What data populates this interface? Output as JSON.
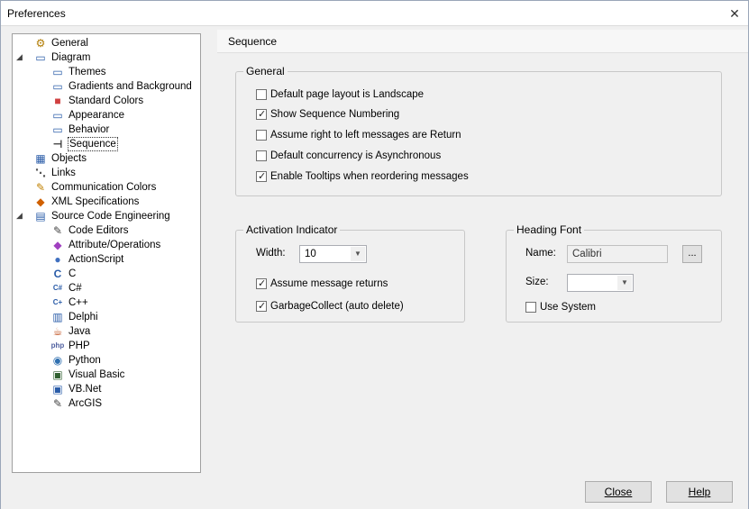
{
  "window": {
    "title": "Preferences",
    "close_glyph": "✕"
  },
  "tree": {
    "items": [
      {
        "label": "General",
        "icon": "general-icon",
        "level": 0
      },
      {
        "label": "Diagram",
        "icon": "diagram-icon",
        "level": 0,
        "expanded": true
      },
      {
        "label": "Themes",
        "icon": "page-icon",
        "level": 1
      },
      {
        "label": "Gradients and Background",
        "icon": "page-icon",
        "level": 1
      },
      {
        "label": "Standard Colors",
        "icon": "colors-icon",
        "level": 1
      },
      {
        "label": "Appearance",
        "icon": "page-icon",
        "level": 1
      },
      {
        "label": "Behavior",
        "icon": "page-icon",
        "level": 1
      },
      {
        "label": "Sequence",
        "icon": "sequence-icon",
        "level": 1,
        "selected": true
      },
      {
        "label": "Objects",
        "icon": "objects-icon",
        "level": 0
      },
      {
        "label": "Links",
        "icon": "links-icon",
        "level": 0
      },
      {
        "label": "Communication Colors",
        "icon": "communication-colors-icon",
        "level": 0
      },
      {
        "label": "XML Specifications",
        "icon": "xml-icon",
        "level": 0
      },
      {
        "label": "Source Code Engineering",
        "icon": "source-code-icon",
        "level": 0,
        "expanded": true
      },
      {
        "label": "Code Editors",
        "icon": "code-editor-icon",
        "level": 1
      },
      {
        "label": "Attribute/Operations",
        "icon": "attribute-icon",
        "level": 1
      },
      {
        "label": "ActionScript",
        "icon": "actionscript-icon",
        "level": 1
      },
      {
        "label": "C",
        "icon": "c-icon",
        "level": 1
      },
      {
        "label": "C#",
        "icon": "csharp-icon",
        "level": 1
      },
      {
        "label": "C++",
        "icon": "cpp-icon",
        "level": 1
      },
      {
        "label": "Delphi",
        "icon": "delphi-icon",
        "level": 1
      },
      {
        "label": "Java",
        "icon": "java-icon",
        "level": 1
      },
      {
        "label": "PHP",
        "icon": "php-icon",
        "level": 1
      },
      {
        "label": "Python",
        "icon": "python-icon",
        "level": 1
      },
      {
        "label": "Visual Basic",
        "icon": "visual-basic-icon",
        "level": 1
      },
      {
        "label": "VB.Net",
        "icon": "vbnet-icon",
        "level": 1
      },
      {
        "label": "ArcGIS",
        "icon": "arcgis-icon",
        "level": 1
      }
    ]
  },
  "panel": {
    "title": "Sequence",
    "general": {
      "title": "General",
      "options": [
        {
          "label": "Default page layout is Landscape",
          "checked": false
        },
        {
          "label": "Show Sequence Numbering",
          "checked": true
        },
        {
          "label": "Assume right to left messages are Return",
          "checked": false
        },
        {
          "label": "Default concurrency is Asynchronous",
          "checked": false
        },
        {
          "label": "Enable Tooltips when reordering messages",
          "checked": true
        }
      ]
    },
    "activation": {
      "title": "Activation Indicator",
      "width_label": "Width:",
      "width_value": "10",
      "options": [
        {
          "label": "Assume message returns",
          "checked": true
        },
        {
          "label": "GarbageCollect (auto delete)",
          "checked": true
        }
      ]
    },
    "heading_font": {
      "title": "Heading Font",
      "name_label": "Name:",
      "name_value": "Calibri",
      "browse_label": "...",
      "size_label": "Size:",
      "size_value": "",
      "use_system_label": "Use System",
      "use_system_checked": false
    }
  },
  "footer": {
    "close_label": "Close",
    "help_label": "Help"
  }
}
